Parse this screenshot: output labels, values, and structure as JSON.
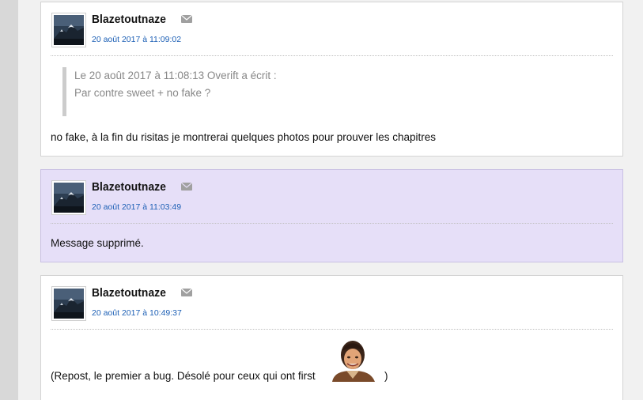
{
  "posts": [
    {
      "author": "Blazetoutnaze",
      "date": "20 août 2017 à 11:09:02",
      "quote": {
        "header": "Le 20 août 2017 à 11:08:13 Overift a écrit :",
        "text": "Par contre sweet + no fake ?"
      },
      "body": "no fake, à la fin du risitas je montrerai quelques photos pour prouver les chapitres"
    },
    {
      "author": "Blazetoutnaze",
      "date": "20 août 2017 à 11:03:49",
      "body": "Message supprimé."
    },
    {
      "author": "Blazetoutnaze",
      "date": "20 août 2017 à 10:49:37",
      "body_before": "(Repost, le premier a bug. Désolé pour ceux qui ont first",
      "body_after": ")",
      "sticker_icon": "risitas-sticker"
    }
  ],
  "icons": {
    "mail": "envelope-icon",
    "avatar": "mountain-avatar"
  },
  "colors": {
    "date_link": "#1c5fb5",
    "deleted_bg": "#e6dff8",
    "quote_text": "#888888"
  }
}
